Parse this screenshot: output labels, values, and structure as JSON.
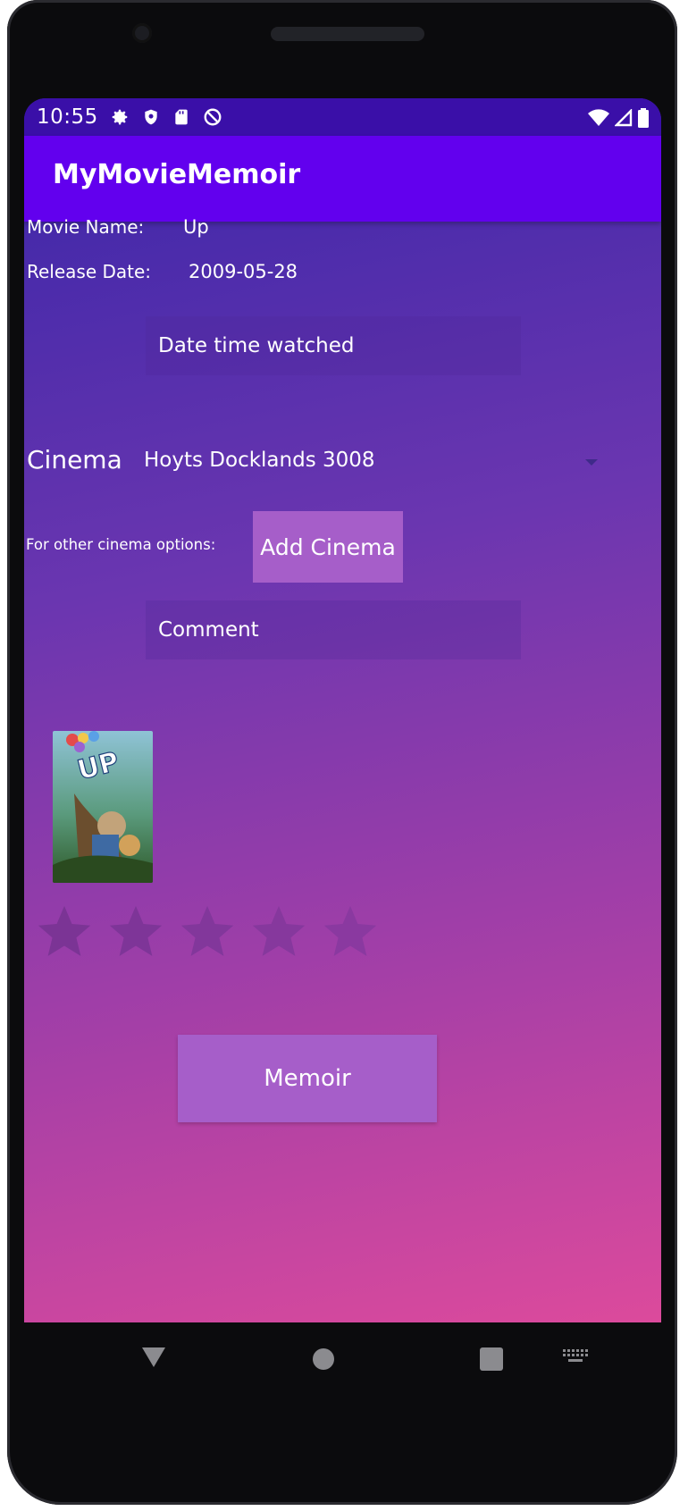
{
  "status_bar": {
    "time": "10:55",
    "icons": [
      "gear-icon",
      "shield-icon",
      "sd-card-icon",
      "no-disturb-icon"
    ],
    "right_icons": [
      "wifi-icon",
      "signal-icon",
      "battery-icon"
    ]
  },
  "app_bar": {
    "title": "MyMovieMemoir"
  },
  "movie": {
    "name_label": "Movie Name:",
    "name_value": "Up",
    "release_label": "Release Date:",
    "release_value": "2009-05-28"
  },
  "form": {
    "date_placeholder": "Date time watched",
    "cinema_label": "Cinema",
    "cinema_selected": "Hoyts Docklands 3008",
    "other_label": "For other cinema options:",
    "add_cinema_label": "Add Cinema",
    "comment_placeholder": "Comment",
    "poster_title": "UP",
    "rating": {
      "value": 0,
      "max": 5
    },
    "memoir_label": "Memoir"
  },
  "colors": {
    "app_bar": "#6200ee",
    "status_bar": "#3a0fa8",
    "button": "#a65ec9",
    "gradient_top": "#3a26a8",
    "gradient_bottom": "#dc4a9c",
    "star_empty": "#7b3495"
  },
  "nav_bar": {
    "icons": [
      "back-icon",
      "home-icon",
      "recents-icon",
      "keyboard-icon"
    ]
  }
}
